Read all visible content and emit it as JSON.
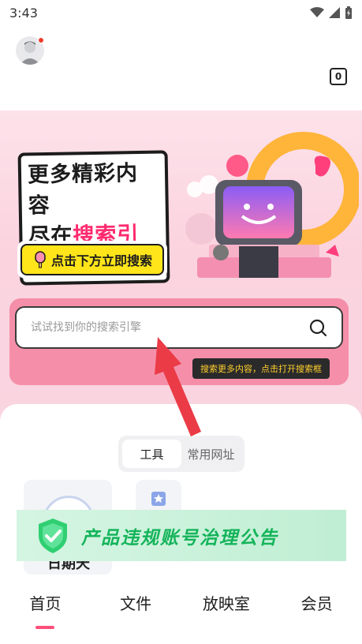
{
  "status_bar": {
    "time": "3:43"
  },
  "header": {
    "tab_count": "0"
  },
  "banner": {
    "line1": "更多精彩内容",
    "line2_prefix": "尽在",
    "line2_highlight": "搜索引擎",
    "cta_label": "点击下方立即搜索"
  },
  "search": {
    "placeholder": "试试找到你的搜索引擎",
    "tooltip": "搜索更多内容，点击打开搜索框"
  },
  "segment": {
    "tabs": [
      {
        "label": "工具"
      },
      {
        "label": "常用网址"
      }
    ]
  },
  "tiles": {
    "tile1_label": "日期天"
  },
  "notice": {
    "text": "产品违规账号治理公告"
  },
  "bottom_nav": {
    "items": [
      {
        "label": "首页"
      },
      {
        "label": "文件"
      },
      {
        "label": "放映室"
      },
      {
        "label": "会员"
      }
    ]
  },
  "colors": {
    "accent": "#ff4f7a",
    "search_frame": "#f58fa9",
    "notice_green": "#14b45a",
    "cta_yellow": "#ffe51a"
  }
}
